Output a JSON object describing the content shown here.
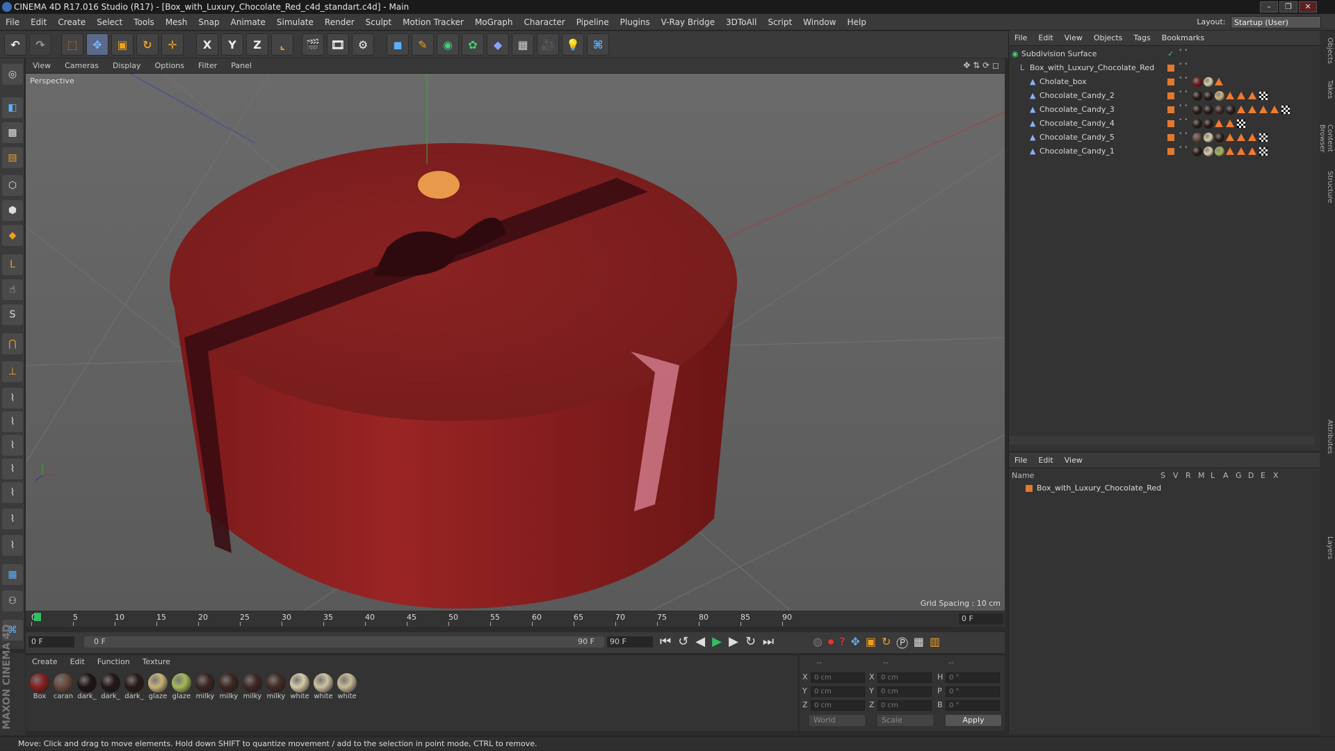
{
  "window": {
    "title": "CINEMA 4D R17.016 Studio (R17) - [Box_with_Luxury_Chocolate_Red_c4d_standart.c4d] - Main"
  },
  "menubar": [
    "File",
    "Edit",
    "Create",
    "Select",
    "Tools",
    "Mesh",
    "Snap",
    "Animate",
    "Simulate",
    "Render",
    "Sculpt",
    "Motion Tracker",
    "MoGraph",
    "Character",
    "Pipeline",
    "Plugins",
    "V-Ray Bridge",
    "3DToAll",
    "Script",
    "Window",
    "Help"
  ],
  "layout": {
    "label": "Layout:",
    "value": "Startup (User)"
  },
  "toolbar": {
    "x_label": "X",
    "y_label": "Y",
    "z_label": "Z"
  },
  "viewport": {
    "menu": [
      "View",
      "Cameras",
      "Display",
      "Options",
      "Filter",
      "Panel"
    ],
    "label": "Perspective",
    "grid_spacing": "Grid Spacing : 10 cm"
  },
  "timeline": {
    "ticks": [
      "0",
      "5",
      "10",
      "15",
      "20",
      "25",
      "30",
      "35",
      "40",
      "45",
      "50",
      "55",
      "60",
      "65",
      "70",
      "75",
      "80",
      "85",
      "90"
    ],
    "end_frame": "0 F"
  },
  "transport": {
    "current": "0 F",
    "range_start": "0 F",
    "range_end": "90 F",
    "max": "90 F"
  },
  "materials": {
    "menu": [
      "Create",
      "Edit",
      "Function",
      "Texture"
    ],
    "items": [
      {
        "label": "Box",
        "color": "#8a1f1f"
      },
      {
        "label": "caran",
        "color": "#6b4a3d"
      },
      {
        "label": "dark_",
        "color": "#1e1412"
      },
      {
        "label": "dark_",
        "color": "#231715"
      },
      {
        "label": "dark_",
        "color": "#2a1a17"
      },
      {
        "label": "glaze",
        "color": "#c9b47a"
      },
      {
        "label": "glaze",
        "color": "#a6b85a"
      },
      {
        "label": "milky",
        "color": "#3a2420"
      },
      {
        "label": "milky",
        "color": "#3d2621"
      },
      {
        "label": "milky",
        "color": "#402823"
      },
      {
        "label": "milky",
        "color": "#432a25"
      },
      {
        "label": "white",
        "color": "#d8cba8"
      },
      {
        "label": "white",
        "color": "#cfc2a0"
      },
      {
        "label": "white",
        "color": "#c9bb98"
      }
    ]
  },
  "coords": {
    "headers": [
      "--",
      "--",
      "--"
    ],
    "rows": [
      {
        "a": "X",
        "av": "0 cm",
        "b": "X",
        "bv": "0 cm",
        "c": "H",
        "cv": "0 °"
      },
      {
        "a": "Y",
        "av": "0 cm",
        "b": "Y",
        "bv": "0 cm",
        "c": "P",
        "cv": "0 °"
      },
      {
        "a": "Z",
        "av": "0 cm",
        "b": "Z",
        "bv": "0 cm",
        "c": "B",
        "cv": "0 °"
      }
    ],
    "world": "World",
    "scale": "Scale",
    "apply": "Apply"
  },
  "objects": {
    "menu": [
      "File",
      "Edit",
      "View",
      "Objects",
      "Tags",
      "Bookmarks"
    ],
    "items": [
      {
        "name": "Subdivision Surface"
      },
      {
        "name": "Box_with_Luxury_Chocolate_Red"
      },
      {
        "name": "Cholate_box"
      },
      {
        "name": "Chocolate_Candy_2"
      },
      {
        "name": "Chocolate_Candy_3"
      },
      {
        "name": "Chocolate_Candy_4"
      },
      {
        "name": "Chocolate_Candy_5"
      },
      {
        "name": "Chocolate_Candy_1"
      }
    ]
  },
  "layers": {
    "menu": [
      "File",
      "Edit",
      "View"
    ],
    "columns": [
      "Name",
      "S",
      "V",
      "R",
      "M",
      "L",
      "A",
      "G",
      "D",
      "E",
      "X"
    ],
    "items": [
      {
        "name": "Box_with_Luxury_Chocolate_Red"
      }
    ]
  },
  "side_tabs": [
    "Objects",
    "Takes",
    "Content Browser",
    "Structure",
    "Attributes",
    "Layers"
  ],
  "status": "Move: Click and drag to move elements. Hold down SHIFT to quantize movement / add to the selection in point mode, CTRL to remove.",
  "brand": "MAXON CINEMA 4D"
}
